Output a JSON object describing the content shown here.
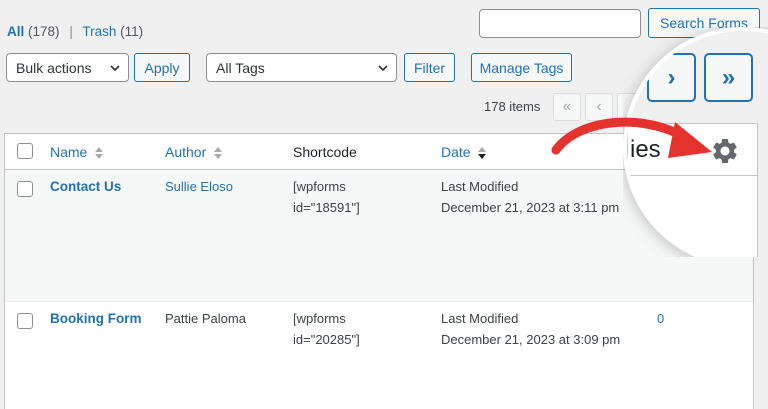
{
  "filters": {
    "all_label": "All",
    "all_count": "(178)",
    "separator": "|",
    "trash_label": "Trash",
    "trash_count": "(11)"
  },
  "search": {
    "placeholder": "",
    "button_label": "Search Forms"
  },
  "toolbar": {
    "bulk_selected": "Bulk actions",
    "apply_label": "Apply",
    "tags_selected": "All Tags",
    "filter_label": "Filter",
    "manage_tags_label": "Manage Tags"
  },
  "pagination": {
    "items_count": "178 items",
    "first": "«",
    "prev": "‹",
    "next": "›",
    "last": "»"
  },
  "table": {
    "headers": {
      "name": "Name",
      "author": "Author",
      "shortcode": "Shortcode",
      "date": "Date"
    },
    "rows": [
      {
        "name": "Contact Us",
        "author": "Sullie Eloso",
        "shortcode_line1": "[wpforms",
        "shortcode_line2": "id=\"18591\"]",
        "date_line1": "Last Modified",
        "date_line2": "December 21, 2023 at 3:11 pm",
        "entries": ""
      },
      {
        "name": "Booking Form",
        "author": "Pattie Paloma",
        "shortcode_line1": "[wpforms",
        "shortcode_line2": "id=\"20285\"]",
        "date_line1": "Last Modified",
        "date_line2": "December 21, 2023 at 3:09 pm",
        "entries": "0"
      }
    ]
  },
  "zoom": {
    "column_partial": "ies",
    "next": "›",
    "last": "»"
  },
  "colors": {
    "accent": "#2271b1",
    "arrow": "#e5322d",
    "gear": "#646970"
  },
  "icons": [
    "chevron-down-icon",
    "sort-icon",
    "sort-desc-icon",
    "gear-icon",
    "curved-arrow-icon"
  ]
}
